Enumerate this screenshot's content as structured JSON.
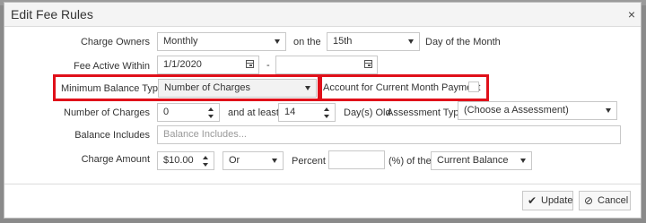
{
  "dialog": {
    "title": "Edit Fee Rules",
    "close_glyph": "×"
  },
  "form": {
    "charge_owners_label": "Charge Owners",
    "charge_owners_value": "Monthly",
    "on_the_label": "on the",
    "day_value": "15th",
    "day_of_month_label": "Day of the Month",
    "fee_active_label": "Fee Active Within",
    "fee_active_from": "1/1/2020",
    "fee_active_dash": "-",
    "fee_active_to": "",
    "min_balance_label": "Minimum Balance Type",
    "min_balance_value": "Number of Charges",
    "account_current_label": "Account for Current Month Payment",
    "num_charges_label": "Number of Charges",
    "num_charges_value": "0",
    "and_at_least_label": "and at least",
    "days_old_value": "14",
    "days_old_label": "Day(s) Old",
    "assessment_type_label": "Assessment Type",
    "assessment_type_value": "(Choose a Assessment)",
    "balance_includes_label": "Balance Includes",
    "balance_includes_placeholder": "Balance Includes...",
    "charge_amount_label": "Charge Amount",
    "charge_amount_value": "$10.00",
    "or_value": "Or",
    "percent_label": "Percent",
    "percent_value": "",
    "percent_of_label": "(%)  of the",
    "balance_basis_value": "Current Balance"
  },
  "buttons": {
    "update_label": "Update",
    "cancel_label": "Cancel"
  },
  "icons": {
    "update": "check-icon",
    "cancel": "ban-icon"
  },
  "colors": {
    "highlight": "#e0101a"
  }
}
